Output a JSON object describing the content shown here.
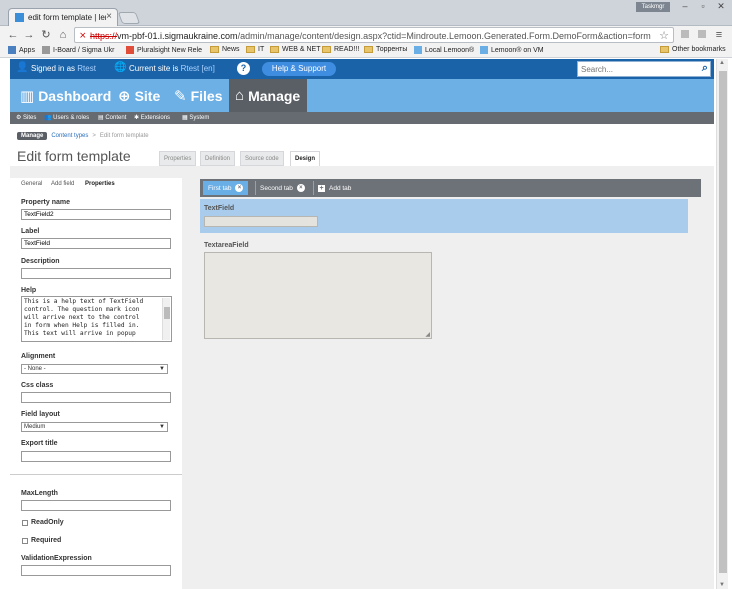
{
  "browser": {
    "tab_title": "edit form template | lemo",
    "tab_close": "×",
    "user_badge": "Taskmgr",
    "url_prefix": "https://",
    "url_host": "vm-pbf-01.i.sigmaukraine.com",
    "url_path": "/admin/manage/content/design.aspx?ctid=Mindroute.Lemoon.Generated.Form.DemoForm&action=form",
    "menu_glyph": "≡"
  },
  "bookmarks": {
    "items": [
      {
        "label": "Apps"
      },
      {
        "label": "I-Board / Sigma Ukr"
      },
      {
        "label": "Pluralsight New Rele"
      },
      {
        "label": "News"
      },
      {
        "label": "IT"
      },
      {
        "label": "WEB & NET"
      },
      {
        "label": "READ!!!"
      },
      {
        "label": "Торренты"
      },
      {
        "label": "Local Lemoon®"
      },
      {
        "label": "Lemoon® on VM"
      }
    ],
    "other": "Other bookmarks"
  },
  "topbar": {
    "signed_in_label": "Signed in as",
    "signed_in_user": "Rtest",
    "current_site_label": "Current site is",
    "current_site_value": "Rtest [en]",
    "help_button": "Help & Support",
    "search_placeholder": "Search..."
  },
  "mainnav": {
    "items": [
      {
        "label": "Dashboard",
        "icon": "bar-chart-icon"
      },
      {
        "label": "Site",
        "icon": "globe-icon"
      },
      {
        "label": "Files",
        "icon": "paperclip-icon"
      },
      {
        "label": "Manage",
        "icon": "factory-icon",
        "active": true
      }
    ]
  },
  "subnav": {
    "items": [
      {
        "label": "Sites"
      },
      {
        "label": "Users & roles"
      },
      {
        "label": "Content"
      },
      {
        "label": "Extensions"
      },
      {
        "label": "System"
      }
    ]
  },
  "breadcrumb": {
    "root": "Manage",
    "link": "Content types",
    "separator": ">",
    "current": "Edit form template"
  },
  "page": {
    "title": "Edit form template",
    "tabs": [
      {
        "label": "Properties"
      },
      {
        "label": "Definition"
      },
      {
        "label": "Source code"
      },
      {
        "label": "Design",
        "active": true
      }
    ]
  },
  "leftpanel": {
    "tabs": [
      {
        "label": "General"
      },
      {
        "label": "Add field"
      },
      {
        "label": "Properties",
        "active": true
      }
    ],
    "property_name_label": "Property name",
    "property_name_value": "TextField2",
    "label_label": "Label",
    "label_value": "TextField",
    "description_label": "Description",
    "description_value": "",
    "help_label": "Help",
    "help_text": "This is a help text of TextField\ncontrol. The question mark icon\nwill arrive next to the control\nin form when Help is filled in.\nThis text will arrive in popup",
    "alignment_label": "Alignment",
    "alignment_value": "- None -",
    "css_class_label": "Css class",
    "css_class_value": "",
    "field_layout_label": "Field layout",
    "field_layout_value": "Medium",
    "export_title_label": "Export title",
    "export_title_value": "",
    "max_length_label": "MaxLength",
    "max_length_value": "",
    "readonly_label": "ReadOnly",
    "required_label": "Required",
    "validation_label": "ValidationExpression",
    "validation_value": ""
  },
  "design": {
    "tabs": [
      {
        "label": "First tab",
        "active": true
      },
      {
        "label": "Second tab"
      }
    ],
    "add_tab": "Add tab",
    "close_glyph": "×",
    "plus_glyph": "+",
    "fields": [
      {
        "label": "TextField",
        "type": "text"
      },
      {
        "label": "TextareaField",
        "type": "textarea"
      }
    ]
  }
}
